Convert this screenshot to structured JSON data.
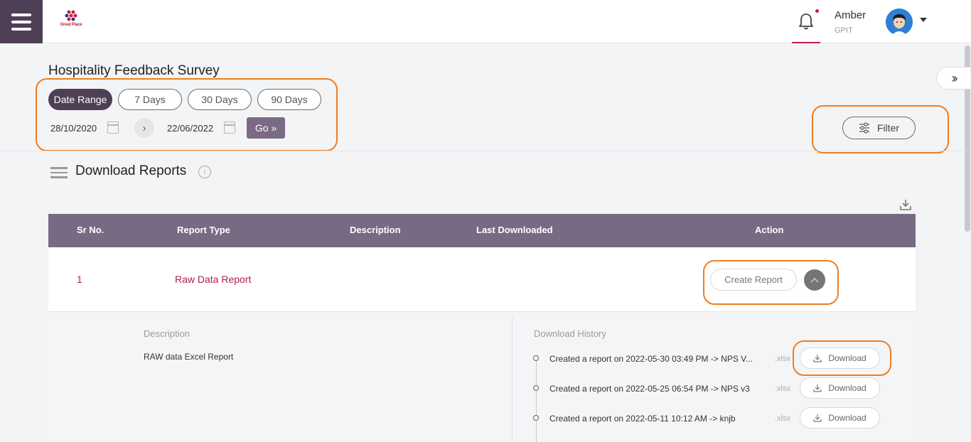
{
  "header": {
    "menu_icon": "hamburger-icon",
    "logo_text": "Great Place",
    "notification_icon": "bell-icon",
    "user_name": "Amber",
    "user_org": "GPIT",
    "caret_icon": "caret-down-icon"
  },
  "page": {
    "title": "Hospitality Feedback Survey",
    "side_toggle": "››"
  },
  "range": {
    "chips": [
      "Date Range",
      "7 Days",
      "30 Days",
      "90 Days"
    ],
    "active_chip": "Date Range",
    "start_date": "28/10/2020",
    "end_date": "22/06/2022",
    "go_label": "Go »",
    "arrow": "›"
  },
  "filter": {
    "label": "Filter"
  },
  "section": {
    "title": "Download Reports",
    "info": "i"
  },
  "table": {
    "headers": [
      "Sr No.",
      "Report Type",
      "Description",
      "Last Downloaded",
      "Action"
    ],
    "rows": [
      {
        "sr": "1",
        "report_type": "Raw Data Report",
        "create_label": "Create Report"
      }
    ]
  },
  "details": {
    "description_label": "Description",
    "description": "RAW data Excel Report",
    "history_label": "Download History",
    "history": [
      {
        "text": "Created a report on 2022-05-30 03:49 PM -> NPS V...",
        "ext": ".xlsx",
        "button": "Download"
      },
      {
        "text": "Created a report on 2022-05-25 06:54 PM -> NPS v3",
        "ext": ".xlsx",
        "button": "Download"
      },
      {
        "text": "Created a report on 2022-05-11 10:12 AM -> knjb",
        "ext": ".xlsx",
        "button": "Download"
      }
    ]
  },
  "colors": {
    "brand_dark": "#4e3f57",
    "table_header": "#786a83",
    "accent_red": "#b0204a",
    "highlight": "#f07d1e"
  }
}
